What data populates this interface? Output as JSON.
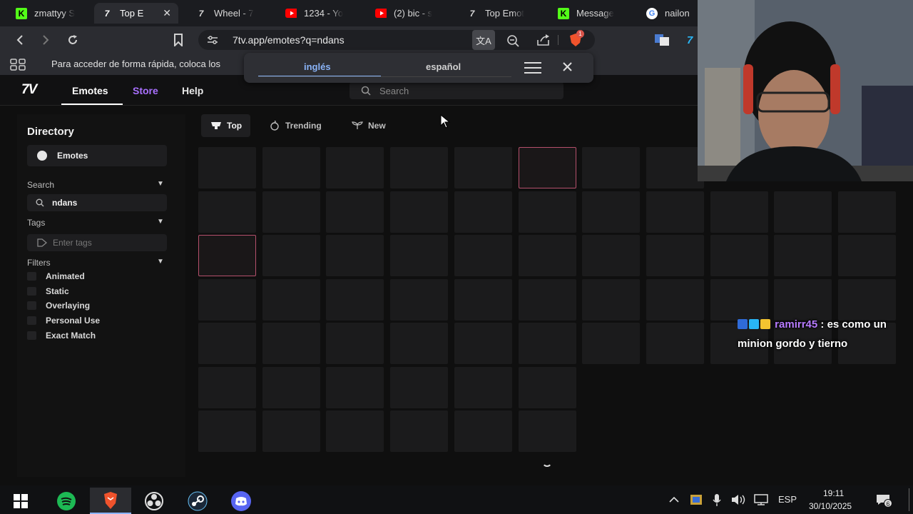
{
  "browser": {
    "tabs": [
      {
        "title": "zmattyy S",
        "icon": "kick-logo-icon",
        "active": false
      },
      {
        "title": "Top E",
        "icon": "7tv-logo-icon",
        "active": true
      },
      {
        "title": "Wheel - 7",
        "icon": "7tv-logo-icon",
        "active": false
      },
      {
        "title": "1234 - Yo",
        "icon": "youtube-icon",
        "active": false
      },
      {
        "title": "(2) bic - s",
        "icon": "youtube-icon",
        "active": false
      },
      {
        "title": "Top Emot",
        "icon": "7tv-logo-icon",
        "active": false
      },
      {
        "title": "Message",
        "icon": "kick-logo-icon",
        "active": false
      },
      {
        "title": "nailon",
        "icon": "google-icon",
        "active": false
      }
    ],
    "url": "7tv.app/emotes?q=ndans",
    "bookmarks_hint": "Para acceder de forma rápida, coloca los",
    "shields_count": "1"
  },
  "translate_popup": {
    "source_language": "inglés",
    "target_language": "español"
  },
  "site": {
    "nav": {
      "emotes": "Emotes",
      "store": "Store",
      "help": "Help"
    },
    "search_placeholder": "Search",
    "sidebar": {
      "title": "Directory",
      "emotes_item": "Emotes",
      "search_label": "Search",
      "search_value": "ndans",
      "tags_label": "Tags",
      "tags_placeholder": "Enter tags",
      "filters_label": "Filters",
      "filters": [
        "Animated",
        "Static",
        "Overlaying",
        "Personal Use",
        "Exact Match"
      ]
    },
    "sort_tabs": [
      "Top",
      "Trending",
      "New"
    ],
    "active_sort": "Top"
  },
  "chat_overlay": {
    "username": "ramirr45",
    "message": "es como un minion gordo y tierno",
    "username_color": "#b77bff"
  },
  "taskbar": {
    "apps": [
      "windows-start-icon",
      "spotify-icon",
      "brave-icon",
      "obs-icon",
      "steam-icon",
      "discord-icon"
    ],
    "language": "ESP",
    "time": "19:11",
    "date": "30/10/2025",
    "notifications": "6"
  },
  "colors": {
    "accent_purple": "#a970ff",
    "kick_green": "#53fc18",
    "youtube_red": "#ff0000",
    "highlight_border": "#b5506c"
  }
}
